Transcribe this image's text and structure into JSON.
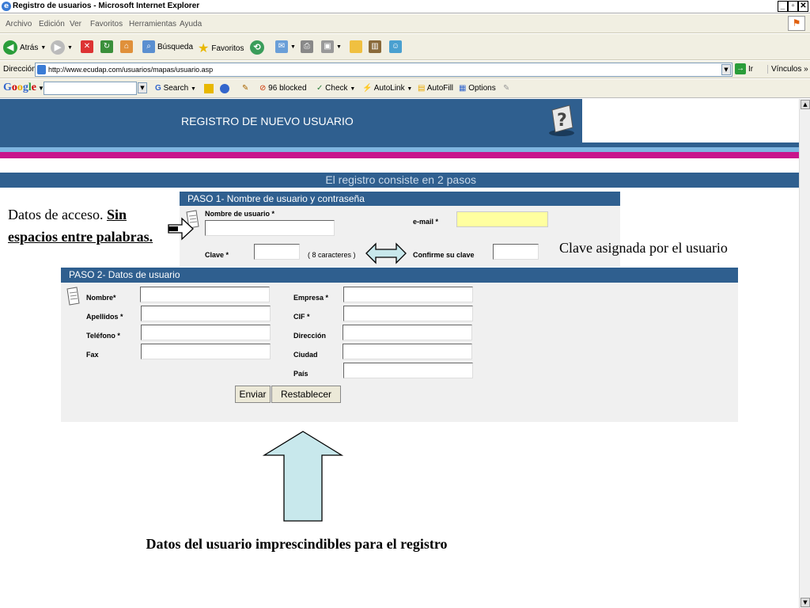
{
  "window": {
    "title": "Registro de usuarios - Microsoft Internet Explorer"
  },
  "menu": [
    "Archivo",
    "Edición",
    "Ver",
    "Favoritos",
    "Herramientas",
    "Ayuda"
  ],
  "toolbar": {
    "back": "Atrás",
    "search": "Búsqueda",
    "favorites": "Favoritos"
  },
  "address": {
    "label": "Dirección",
    "url": "http://www.ecudap.com/usuarios/mapas/usuario.asp",
    "go": "Ir",
    "links": "Vínculos"
  },
  "google": {
    "logo": "Google",
    "search": "Search",
    "blocked": "96 blocked",
    "check": "Check",
    "autolink": "AutoLink",
    "autofill": "AutoFill",
    "options": "Options"
  },
  "page": {
    "banner_title": "REGISTRO DE NUEVO USUARIO",
    "steps_caption": "El registro consiste en 2 pasos",
    "step1": {
      "header": "PASO 1- Nombre de usuario y contraseña",
      "username": "Nombre de usuario *",
      "email": "e-mail *",
      "password": "Clave *",
      "password_hint": "( 8 caracteres )",
      "confirm": "Confirme su clave"
    },
    "step2": {
      "header": "PASO 2- Datos de usuario",
      "nombre": "Nombre*",
      "apellidos": "Apellidos *",
      "telefono": "Teléfono  *",
      "fax": "Fax",
      "empresa": "Empresa *",
      "cif": "CIF *",
      "direccion": "Dirección",
      "ciudad": "Ciudad",
      "pais": "País",
      "submit": "Enviar",
      "reset": "Restablecer"
    }
  },
  "annotations": {
    "access_plain": "Datos de acceso. ",
    "access_bold": "Sin espacios entre palabras.",
    "password_note": "Clave asignada por el usuario",
    "required_note": "Datos del usuario imprescindibles para el registro"
  }
}
